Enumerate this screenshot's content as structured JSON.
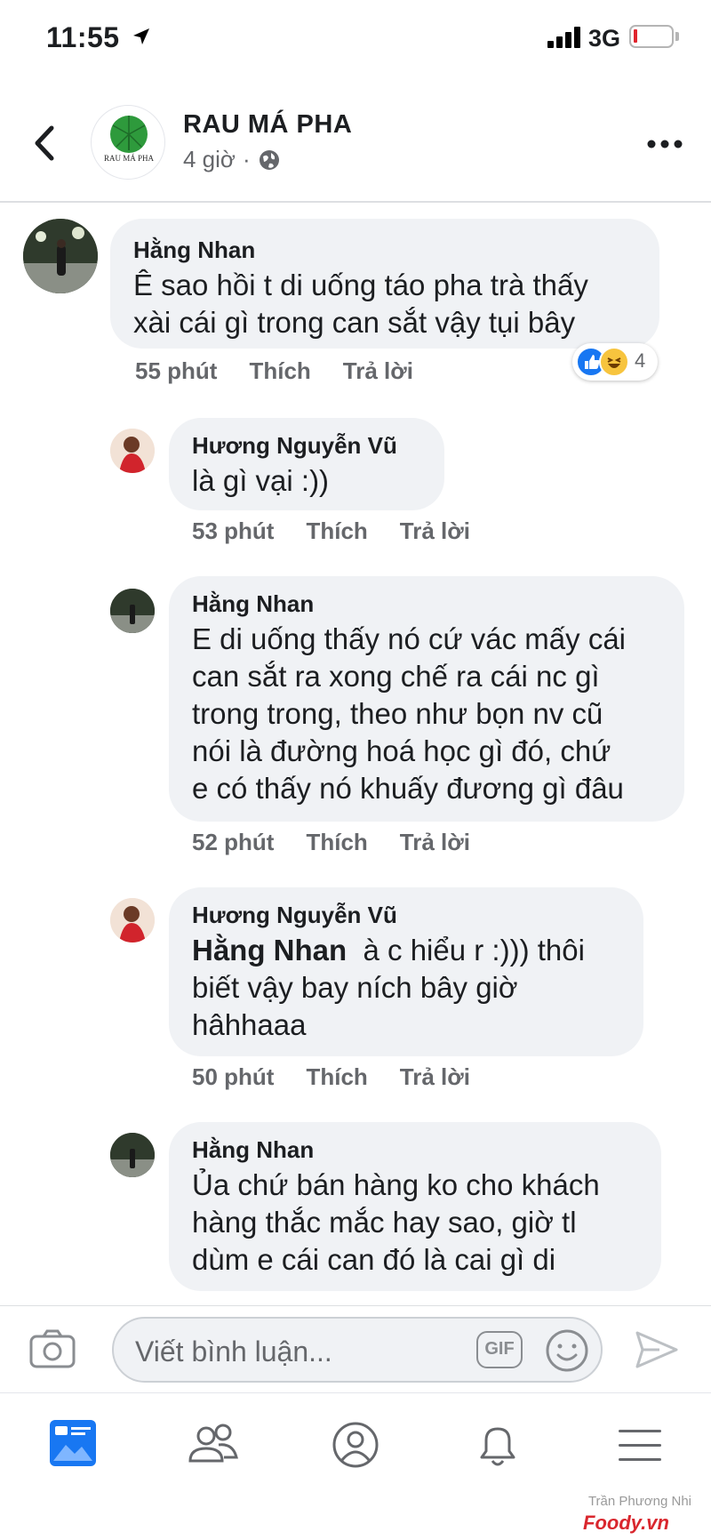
{
  "status_bar": {
    "time": "11:55",
    "network": "3G"
  },
  "header": {
    "page_name": "RAU MÁ PHA",
    "time_ago": "4 giờ",
    "separator": "·",
    "logo_text": "RAU MÁ PHA"
  },
  "reply_label": "Trả lời",
  "like_label": "Thích",
  "comments": [
    {
      "author": "Hằng Nhan",
      "lines": [
        "Ê sao hồi t di uống táo pha trà thấy",
        "xài cái gì trong can sắt vậy tụi bây"
      ],
      "time": "55 phút",
      "reaction_count": "4"
    },
    {
      "author": "Hương Nguyễn Vũ",
      "lines": [
        "là gì vại :))"
      ],
      "time": "53 phút"
    },
    {
      "author": "Hằng Nhan",
      "lines": [
        "E di uống thấy nó cứ vác mấy cái",
        "can sắt ra xong chế ra cái nc gì",
        "trong trong, theo như bọn nv cũ",
        "nói là đường hoá học gì đó, chứ",
        "e có thấy nó khuấy đương gì đâu"
      ],
      "time": "52 phút"
    },
    {
      "author": "Hương Nguyễn Vũ",
      "mention": "Hằng Nhan",
      "lines": [
        "à c hiểu r :))) thôi",
        "biết vậy bay ních bây giờ",
        "hâhhaaa"
      ],
      "time": "50 phút"
    },
    {
      "author": "Hằng Nhan",
      "lines": [
        "Ủa chứ bán hàng ko cho khách",
        "hàng thắc mắc hay sao, giờ tl",
        "dùm e cái can đó là cai gì di"
      ]
    }
  ],
  "composer": {
    "placeholder": "Viết bình luận...",
    "gif_label": "GIF"
  },
  "watermark": {
    "author": "Trần Phương Nhi",
    "brand": "Foody.vn"
  },
  "colors": {
    "accent": "#1877f2",
    "bubble": "#f0f2f5",
    "secondary_text": "#65676b"
  }
}
